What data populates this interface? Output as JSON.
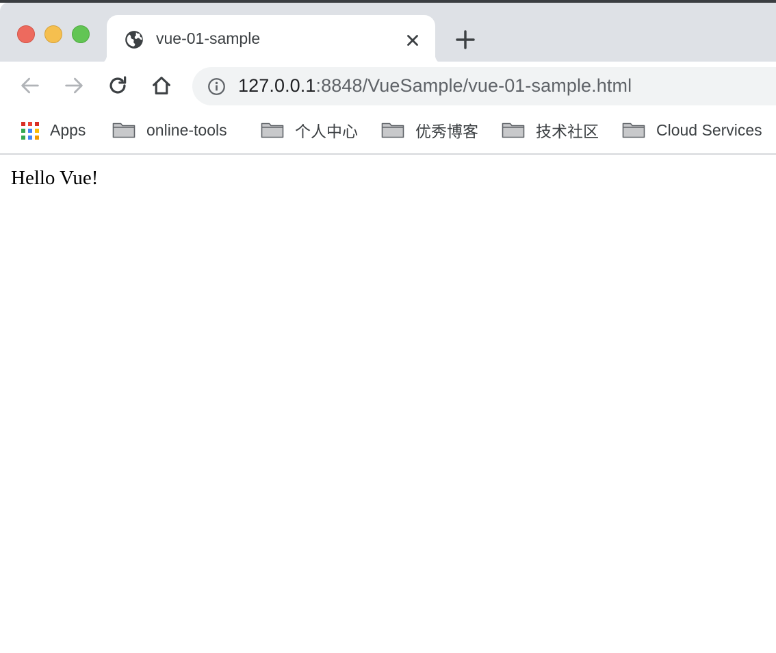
{
  "window": {
    "traffic_lights": {
      "close_color": "#ed6a5e",
      "minimize_color": "#f5bf4f",
      "maximize_color": "#62c554"
    }
  },
  "tab": {
    "title": "vue-01-sample",
    "favicon": "globe-icon",
    "close_icon": "close-icon"
  },
  "new_tab": {
    "icon": "plus-icon"
  },
  "toolbar": {
    "back_icon": "arrow-left-icon",
    "forward_icon": "arrow-right-icon",
    "reload_icon": "reload-icon",
    "home_icon": "home-icon"
  },
  "omnibox": {
    "security_icon": "info-icon",
    "url_host": "127.0.0.1",
    "url_path": ":8848/VueSample/vue-01-sample.html"
  },
  "bookmarks": {
    "items": [
      {
        "label": "Apps",
        "icon": "apps-grid-icon"
      },
      {
        "label": "online-tools",
        "icon": "folder-icon"
      },
      {
        "label": "个人中心",
        "icon": "folder-icon"
      },
      {
        "label": "优秀博客",
        "icon": "folder-icon"
      },
      {
        "label": "技术社区",
        "icon": "folder-icon"
      },
      {
        "label": "Cloud Services",
        "icon": "folder-icon"
      }
    ]
  },
  "content": {
    "text": "Hello Vue!"
  }
}
